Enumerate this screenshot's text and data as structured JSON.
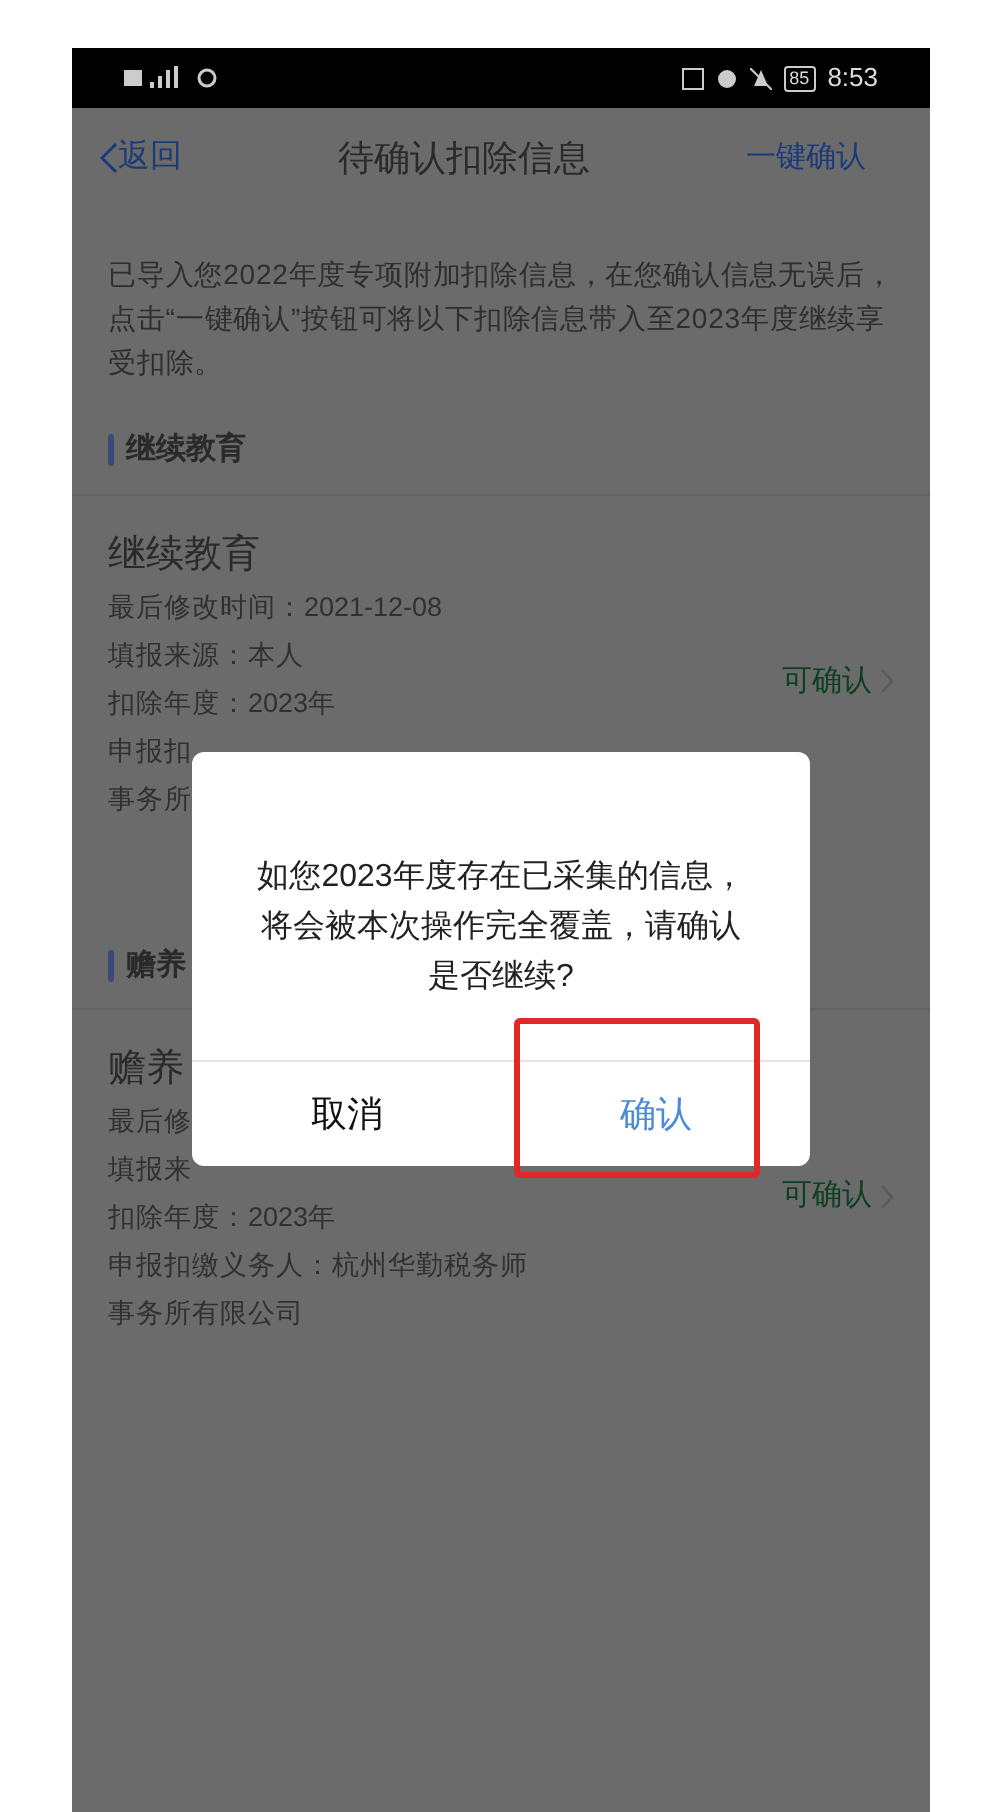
{
  "status_bar": {
    "time": "8:53",
    "battery": "85"
  },
  "nav": {
    "back": "返回",
    "title": "待确认扣除信息",
    "action": "一键确认"
  },
  "notice": "已导入您2022年度专项附加扣除信息，在您确认信息无误后，点击“一键确认”按钮可将以下扣除信息带入至2023年度继续享受扣除。",
  "sections": [
    {
      "heading": "继续教育",
      "card": {
        "title": "继续教育",
        "lines": [
          "最后修改时间：2021-12-08",
          "填报来源：本人",
          "扣除年度：2023年",
          "申报扣",
          "事务所"
        ],
        "status": "可确认"
      }
    },
    {
      "heading": "赡养",
      "card": {
        "title": "赡养",
        "lines": [
          "最后修",
          "填报来",
          "扣除年度：2023年",
          "申报扣缴义务人：杭州华勤税务师",
          "事务所有限公司"
        ],
        "status": "可确认"
      }
    }
  ],
  "dialog": {
    "message": "如您2023年度存在已采集的信息，将会被本次操作完全覆盖，请确认是否继续?",
    "buttons": [
      {
        "label": "取消",
        "kind": "cancel",
        "highlighted": false
      },
      {
        "label": "确认",
        "kind": "confirm",
        "highlighted": true
      }
    ]
  }
}
